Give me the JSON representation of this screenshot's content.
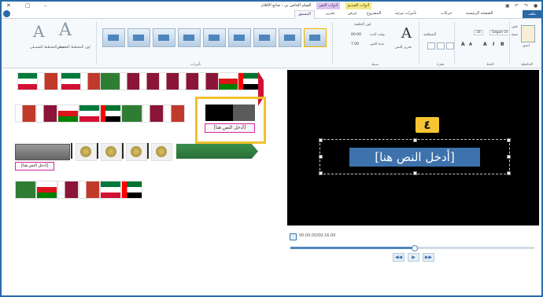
{
  "window": {
    "title": "الفيلم الخاص بي - صانع الأفلام",
    "controls": [
      "✕",
      "▢",
      "–"
    ]
  },
  "context_tabs": {
    "video_tools": "أدوات الفيديو",
    "text_tools": "أدوات النص"
  },
  "tabs": {
    "file": "ملف",
    "home": "الصفحة الرئيسية",
    "animations": "حركات",
    "visual_effects": "تأثيرات مرئية",
    "project": "المشروع",
    "view": "عرض",
    "edit": "تحرير",
    "format": "التنسيق"
  },
  "ribbon": {
    "clipboard": {
      "group": "الحافظة",
      "paste": "لصق",
      "cut": "قص",
      "copy": "نسخ"
    },
    "font": {
      "group": "الخط",
      "font_name": "Segoe UI",
      "font_size": "18"
    },
    "paragraph": {
      "group": "فقرة",
      "transparency": "الشفافية"
    },
    "adjust": {
      "group": "ضبط",
      "text_duration": "مدة النص",
      "start_time": "وقت البدء",
      "bg_color": "لون الخلفية",
      "edit_text": "تحرير النص",
      "start_value": "00:00",
      "duration_value": "7.00"
    },
    "effects": {
      "group": "تأثيرات"
    },
    "outline": {
      "size": "حجم المخطط التفصيلي",
      "color": "لون المخطط التفصيلي"
    }
  },
  "themes": {
    "selected_caption": "[أدخل النص هنا]",
    "gray_caption": "[أدخل النص هنا]"
  },
  "preview": {
    "step_badge": "٤",
    "text": "[أدخل النص هنا]"
  },
  "playback": {
    "time": "00:00.00/00:16.00",
    "prev": "◀◀",
    "play": "▶",
    "next": "▶▶"
  },
  "colors": {
    "highlight": "#f2c12e",
    "accent": "#2a6aa8",
    "text_selection": "#3d72ad"
  }
}
